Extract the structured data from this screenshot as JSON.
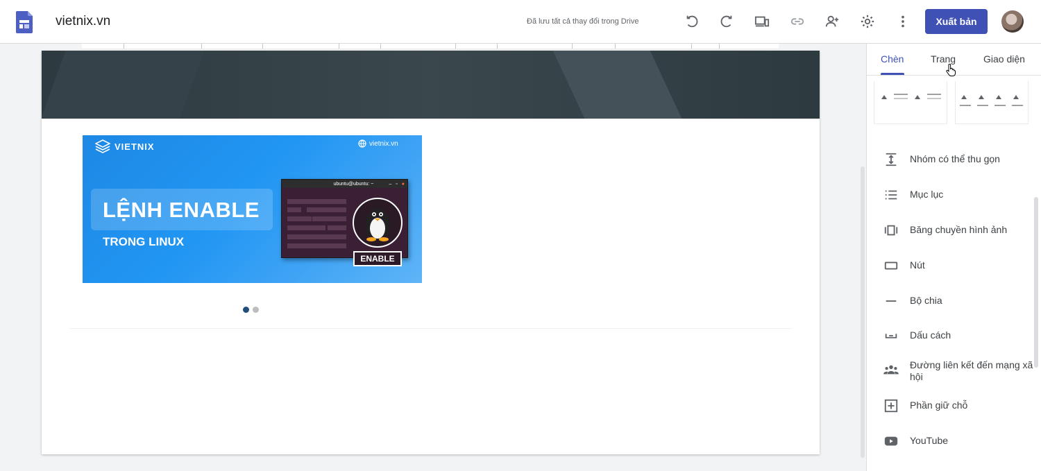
{
  "header": {
    "site_title": "vietnix.vn",
    "save_status": "Đã lưu tất cả thay đổi trong Drive",
    "publish_label": "Xuất bản"
  },
  "banner": {
    "brand": "VIETNIX",
    "site": "vietnix.vn",
    "title_main": "LỆNH ENABLE",
    "title_sub": "TRONG LINUX",
    "terminal_title": "ubuntu@ubuntu: ~",
    "badge": "ENABLE"
  },
  "carousel": {
    "count": 2,
    "active": 0
  },
  "panel": {
    "tabs": [
      {
        "label": "Chèn",
        "active": true
      },
      {
        "label": "Trang",
        "active": false
      },
      {
        "label": "Giao diện",
        "active": false
      }
    ],
    "items": [
      {
        "label": "Nhóm có thể thu gọn",
        "icon": "collapsible-group-icon"
      },
      {
        "label": "Mục lục",
        "icon": "table-of-contents-icon"
      },
      {
        "label": "Băng chuyền hình ảnh",
        "icon": "image-carousel-icon"
      },
      {
        "label": "Nút",
        "icon": "button-icon"
      },
      {
        "label": "Bộ chia",
        "icon": "divider-icon"
      },
      {
        "label": "Dấu cách",
        "icon": "spacer-icon"
      },
      {
        "label": "Đường liên kết đến mạng xã hội",
        "icon": "social-links-icon"
      },
      {
        "label": "Phần giữ chỗ",
        "icon": "placeholder-icon"
      },
      {
        "label": "YouTube",
        "icon": "youtube-icon"
      }
    ]
  },
  "colors": {
    "accent": "#3f51b5",
    "header_band": "#37474f",
    "banner_blue": "#2196f3",
    "active_dot": "#1f4f7a"
  }
}
